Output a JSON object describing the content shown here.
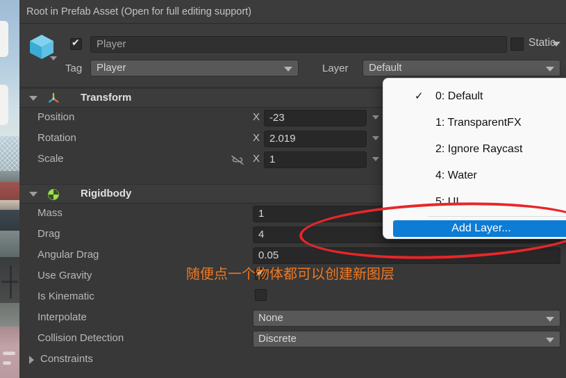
{
  "scene_strip": {
    "name": "scene-view-sliver"
  },
  "prefab_bar": {
    "text": "Root in Prefab Asset (Open for full editing support)"
  },
  "object_header": {
    "enabled": true,
    "name_value": "Player",
    "static_label": "Static",
    "tag_label": "Tag",
    "tag_value": "Player",
    "layer_label": "Layer",
    "layer_value": "Default"
  },
  "components": [
    {
      "title": "Transform",
      "icon": "transform-gizmo-icon",
      "expanded": true,
      "rows": [
        {
          "label": "Position",
          "axis": "X",
          "value": "-23"
        },
        {
          "label": "Rotation",
          "axis": "X",
          "value": "2.019"
        },
        {
          "label": "Scale",
          "axis": "X",
          "value": "1",
          "link_icon": "constrain-proportions-off-icon"
        }
      ]
    },
    {
      "title": "Rigidbody",
      "icon": "rigidbody-icon",
      "expanded": true,
      "rows": [
        {
          "label": "Mass",
          "value": "1",
          "type": "number"
        },
        {
          "label": "Drag",
          "value": "4",
          "type": "number"
        },
        {
          "label": "Angular Drag",
          "value": "0.05",
          "type": "number"
        },
        {
          "label": "Use Gravity",
          "value": true,
          "type": "bool"
        },
        {
          "label": "Is Kinematic",
          "value": false,
          "type": "bool"
        },
        {
          "label": "Interpolate",
          "value": "None",
          "type": "enum"
        },
        {
          "label": "Collision Detection",
          "value": "Discrete",
          "type": "enum"
        },
        {
          "label": "Constraints",
          "type": "foldout"
        }
      ]
    }
  ],
  "layer_menu": {
    "items": [
      {
        "label": "0: Default",
        "checked": true
      },
      {
        "label": "1: TransparentFX",
        "checked": false
      },
      {
        "label": "2: Ignore Raycast",
        "checked": false
      },
      {
        "label": "4: Water",
        "checked": false
      },
      {
        "label": "5: UI",
        "checked": false
      }
    ],
    "check_glyph": "✓",
    "add_layer_label": "Add Layer..."
  },
  "annotations": {
    "note_text": "随便点一个物体都可以创建新图层",
    "note_color": "#f07820",
    "ellipse_color": "#e8262a"
  },
  "colors": {
    "panel_bg": "#383838",
    "header_bg": "#3c3c3c",
    "field_bg": "#282828",
    "enum_bg": "#585858",
    "accent_blue": "#0c7cd5",
    "menu_bg": "#f9f9f9"
  }
}
